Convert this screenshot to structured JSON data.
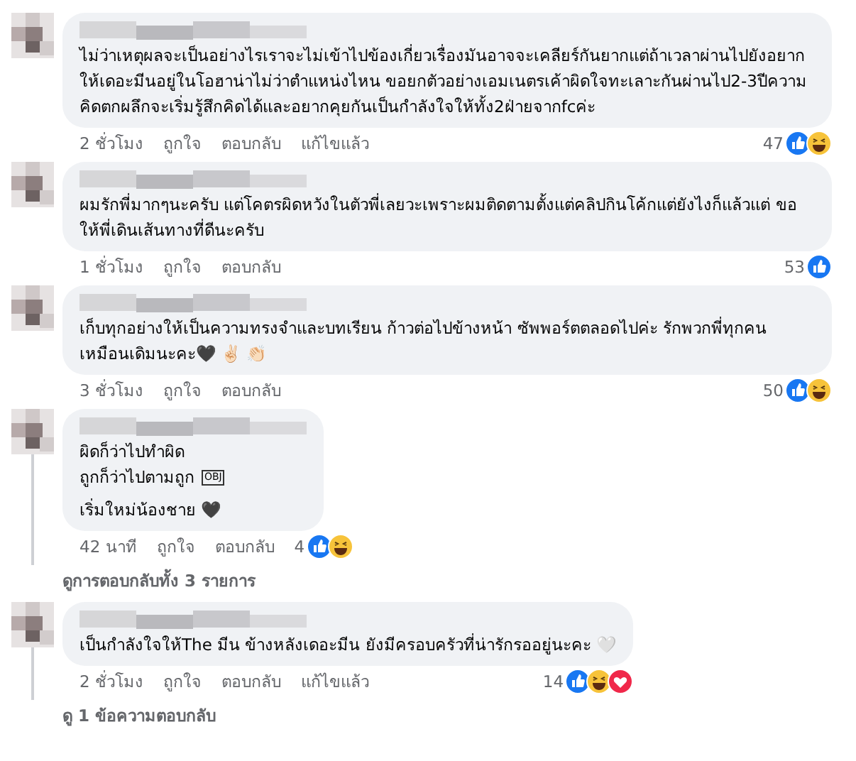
{
  "items": [
    {
      "kind": "comment",
      "thread": false,
      "text": "ไม่ว่าเหตุผลจะเป็นอย่างไรเราจะไม่เข้าไปข้องเกี่ยวเรื่องมันอาจจะเคลียร์กันยากแต่ถ้าเวลาผ่านไปยังอยากให้เดอะมีนอยู่ในโอฮาน่าไม่ว่าตำแหน่งไหน ขอยกตัวอย่างเอมเนตรเค้าผิดใจทะเลาะกันผ่านไป2-3ปีความคิดตกผลึกจะเริ่มรู้สึกคิดได้และอยากคุยกันเป็นกำลังใจให้ทั้ง2ฝ่ายจากfcค่ะ",
      "time": "2 ชั่วโมง",
      "actions": [
        "ถูกใจ",
        "ตอบกลับ"
      ],
      "edited": "แก้ไขแล้ว",
      "count": "47",
      "reactions": [
        {
          "kind": "like"
        },
        {
          "kind": "haha"
        }
      ]
    },
    {
      "kind": "comment",
      "thread": false,
      "text": "ผมรักพี่มากๆนะครับ แต่โคตรผิดหวังในตัวพี่เลยวะเพราะผมติดตามตั้งแต่คลิปกินโค้กแต่ยังไงก็แล้วแต่ ขอให้พี่เดินเส้นทางที่ดีนะครับ",
      "time": "1 ชั่วโมง",
      "actions": [
        "ถูกใจ",
        "ตอบกลับ"
      ],
      "count": "53",
      "reactions": [
        {
          "kind": "like"
        }
      ]
    },
    {
      "kind": "comment",
      "thread": false,
      "text": "เก็บทุกอย่างให้เป็นความทรงจำและบทเรียน ก้าวต่อไปข้างหน้า ซัพพอร์ตตลอดไปค่ะ รักพวกพี่ทุกคนเหมือนเดิมนะคะ🖤 ✌🏻 👏🏻",
      "time": "3 ชั่วโมง",
      "actions": [
        "ถูกใจ",
        "ตอบกลับ"
      ],
      "count": "50",
      "reactions": [
        {
          "kind": "like"
        },
        {
          "kind": "haha"
        }
      ]
    },
    {
      "kind": "comment",
      "thread": true,
      "text": "ผิดก็ว่าไปทำผิด\nถูกก็ว่าไปตามถูก",
      "badge": "OBJ",
      "text_2": "เริ่มใหม่น้องชาย 🖤",
      "time": "42 นาที",
      "actions": [
        "ถูกใจ",
        "ตอบกลับ"
      ],
      "count": "4",
      "reactions": [
        {
          "kind": "like"
        },
        {
          "kind": "haha"
        }
      ]
    },
    {
      "kind": "link",
      "text": "ดูการตอบกลับทั้ง 3 รายการ"
    },
    {
      "kind": "comment",
      "thread": true,
      "text": "เป็นกำลังใจให้The มีน ข้างหลังเดอะมีน ยังมีครอบครัวที่น่ารักรออยู่นะคะ 🤍",
      "time": "2 ชั่วโมง",
      "actions": [
        "ถูกใจ",
        "ตอบกลับ"
      ],
      "edited": "แก้ไขแล้ว",
      "count": "14",
      "reactions": [
        {
          "kind": "like"
        },
        {
          "kind": "haha"
        },
        {
          "kind": "love"
        }
      ]
    },
    {
      "kind": "link",
      "text": "ดู 1 ข้อความตอบกลับ"
    }
  ]
}
